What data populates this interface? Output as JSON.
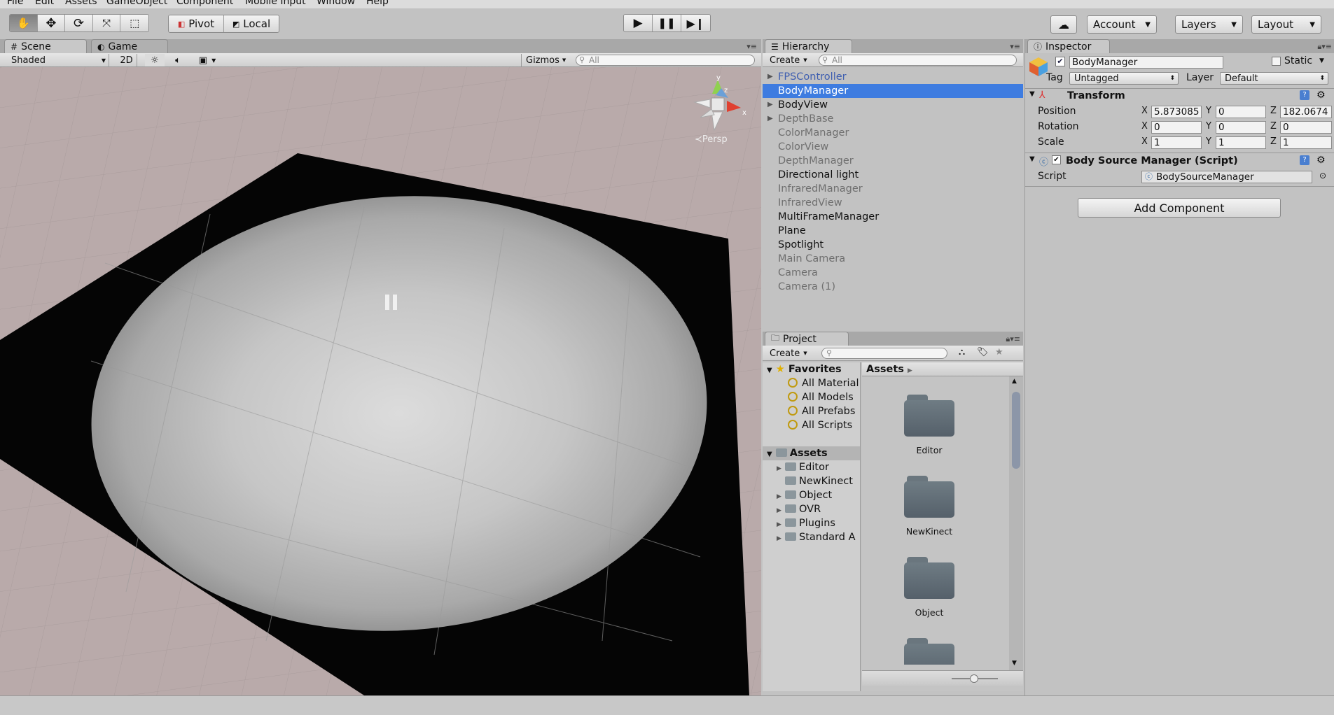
{
  "menu": [
    "File",
    "Edit",
    "Assets",
    "GameObject",
    "Component",
    "Mobile Input",
    "Window",
    "Help"
  ],
  "toolbar": {
    "pivot": "Pivot",
    "local": "Local",
    "account": "Account",
    "layers": "Layers",
    "layout": "Layout"
  },
  "scene": {
    "tab_scene": "Scene",
    "tab_game": "Game",
    "shading_mode": "Shaded",
    "mode_2d": "2D",
    "gizmos": "Gizmos",
    "search_placeholder": "All",
    "persp": "Persp"
  },
  "hierarchy": {
    "title": "Hierarchy",
    "create": "Create",
    "search_placeholder": "All",
    "items": [
      {
        "label": "FPSController",
        "style": "blue",
        "arrow": true
      },
      {
        "label": "BodyManager",
        "style": "sel",
        "arrow": false
      },
      {
        "label": "BodyView",
        "style": "normal",
        "arrow": true
      },
      {
        "label": "DepthBase",
        "style": "dim",
        "arrow": true
      },
      {
        "label": "ColorManager",
        "style": "dim",
        "arrow": false
      },
      {
        "label": "ColorView",
        "style": "dim",
        "arrow": false
      },
      {
        "label": "DepthManager",
        "style": "dim",
        "arrow": false
      },
      {
        "label": "Directional light",
        "style": "normal",
        "arrow": false
      },
      {
        "label": "InfraredManager",
        "style": "dim",
        "arrow": false
      },
      {
        "label": "InfraredView",
        "style": "dim",
        "arrow": false
      },
      {
        "label": "MultiFrameManager",
        "style": "normal",
        "arrow": false
      },
      {
        "label": "Plane",
        "style": "normal",
        "arrow": false
      },
      {
        "label": "Spotlight",
        "style": "normal",
        "arrow": false
      },
      {
        "label": "Main Camera",
        "style": "dim",
        "arrow": false
      },
      {
        "label": "Camera",
        "style": "dim",
        "arrow": false
      },
      {
        "label": "Camera (1)",
        "style": "dim",
        "arrow": false
      }
    ]
  },
  "project": {
    "title": "Project",
    "create": "Create",
    "favorites_label": "Favorites",
    "favorites": [
      "All Material",
      "All Models",
      "All Prefabs",
      "All Scripts"
    ],
    "assets_label": "Assets",
    "asset_tree": [
      {
        "label": "Editor",
        "arrow": true
      },
      {
        "label": "NewKinect",
        "arrow": false
      },
      {
        "label": "Object",
        "arrow": true
      },
      {
        "label": "OVR",
        "arrow": true
      },
      {
        "label": "Plugins",
        "arrow": true
      },
      {
        "label": "Standard A",
        "arrow": true
      }
    ],
    "breadcrumb": "Assets",
    "grid_folders": [
      "Editor",
      "NewKinect",
      "Object",
      ""
    ]
  },
  "inspector": {
    "title": "Inspector",
    "object_name": "BodyManager",
    "static_label": "Static",
    "tag_label": "Tag",
    "tag_value": "Untagged",
    "layer_label": "Layer",
    "layer_value": "Default",
    "transform_title": "Transform",
    "position_label": "Position",
    "rotation_label": "Rotation",
    "scale_label": "Scale",
    "position": {
      "x": "5.873085",
      "y": "0",
      "z": "182.0674"
    },
    "rotation": {
      "x": "0",
      "y": "0",
      "z": "0"
    },
    "scale": {
      "x": "1",
      "y": "1",
      "z": "1"
    },
    "script_component_title": "Body Source Manager (Script)",
    "script_label": "Script",
    "script_value": "BodySourceManager",
    "add_component": "Add Component"
  },
  "axis_letters": {
    "x": "X",
    "y": "Y",
    "z": "Z"
  }
}
